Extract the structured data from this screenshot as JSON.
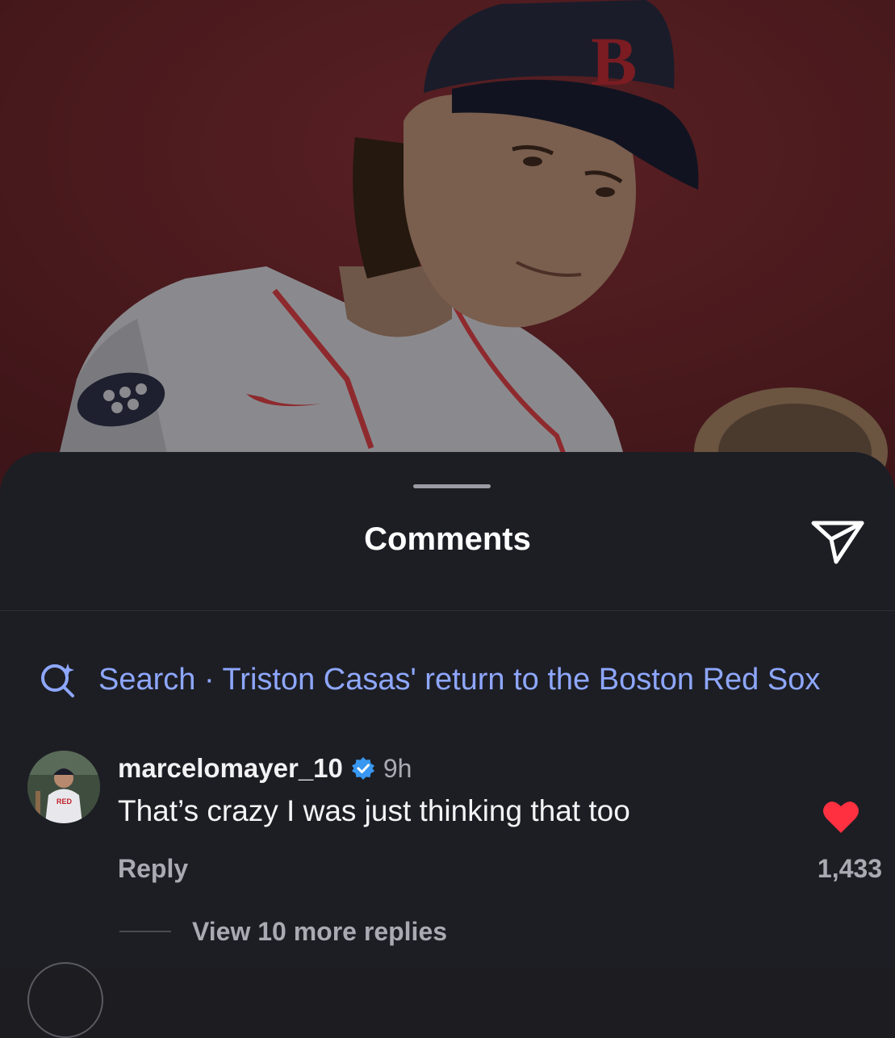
{
  "sheet": {
    "title": "Comments",
    "share_icon": "send-icon"
  },
  "search": {
    "icon": "search-sparkle-icon",
    "text": "Search · Triston Casas' return to the Boston Red Sox",
    "color": "#8ea7ff"
  },
  "comment": {
    "username": "marcelomayer_10",
    "verified": true,
    "time": "9h",
    "text": "That’s crazy I was just thinking that too",
    "liked": true,
    "like_color": "#ff3040",
    "reply_label": "Reply",
    "likes": "1,433",
    "view_replies": "View 10 more replies"
  },
  "colors": {
    "sheet_bg": "#1d1e24",
    "photo_bg": "#4a1a1d",
    "muted_text": "#a9aab2"
  }
}
